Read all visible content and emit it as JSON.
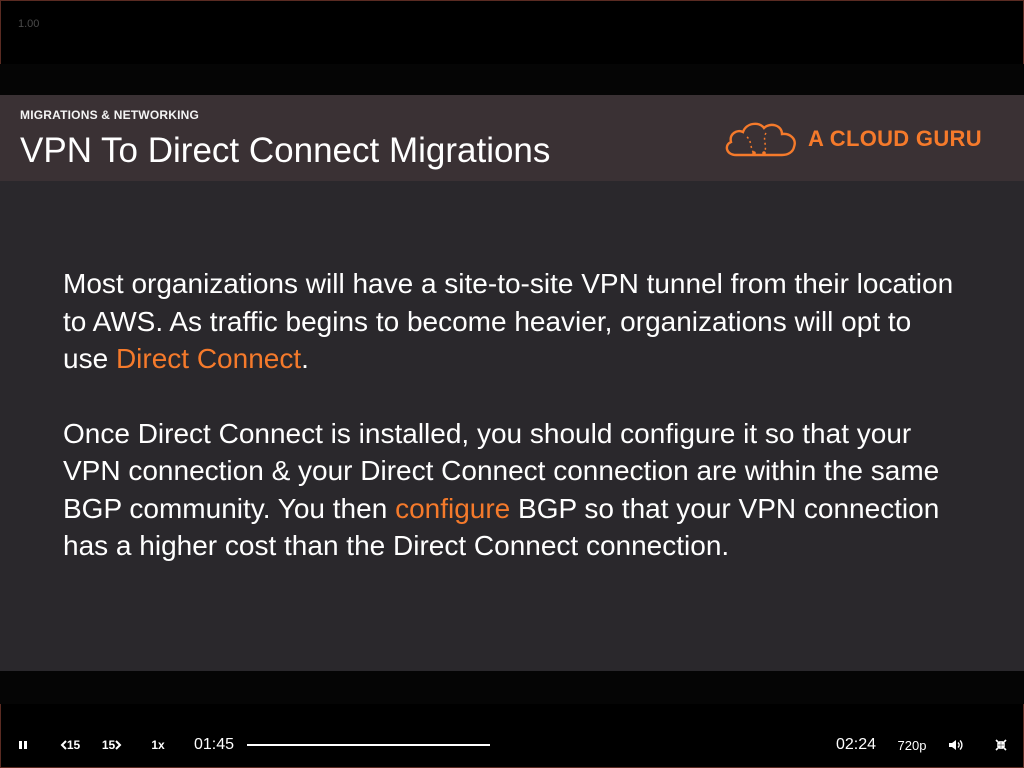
{
  "player": {
    "zoom_readout": "1.00"
  },
  "slide": {
    "kicker": "MIGRATIONS & NETWORKING",
    "title": "VPN To Direct Connect Migrations",
    "logo_text": "A CLOUD GURU",
    "paragraph1": {
      "before": "Most organizations will have a site-to-site VPN tunnel from their location to AWS. As traffic begins to become heavier, organizations will opt to use ",
      "highlight": "Direct Connect",
      "after": "."
    },
    "paragraph2": {
      "before": "Once Direct Connect is installed, you should configure it so that your VPN connection & your Direct Connect connection are within the same BGP community. You then ",
      "highlight": "configure",
      "after": " BGP so that your VPN connection has a higher cost than the Direct Connect connection."
    },
    "colors": {
      "accent": "#f57a2b",
      "slide_bg": "#2a282c",
      "header_bg": "#3a3134"
    }
  },
  "controls": {
    "pause_icon": "pause-icon",
    "rewind_label": "15",
    "rewind_icon": "chevron-left-icon",
    "forward_label": "15",
    "forward_icon": "chevron-right-icon",
    "speed_label": "1x",
    "elapsed": "01:45",
    "duration": "02:24",
    "progress_fraction": 1.0,
    "quality_label": "720p",
    "volume_icon": "volume-icon",
    "exit_fullscreen_icon": "exit-fullscreen-icon"
  }
}
